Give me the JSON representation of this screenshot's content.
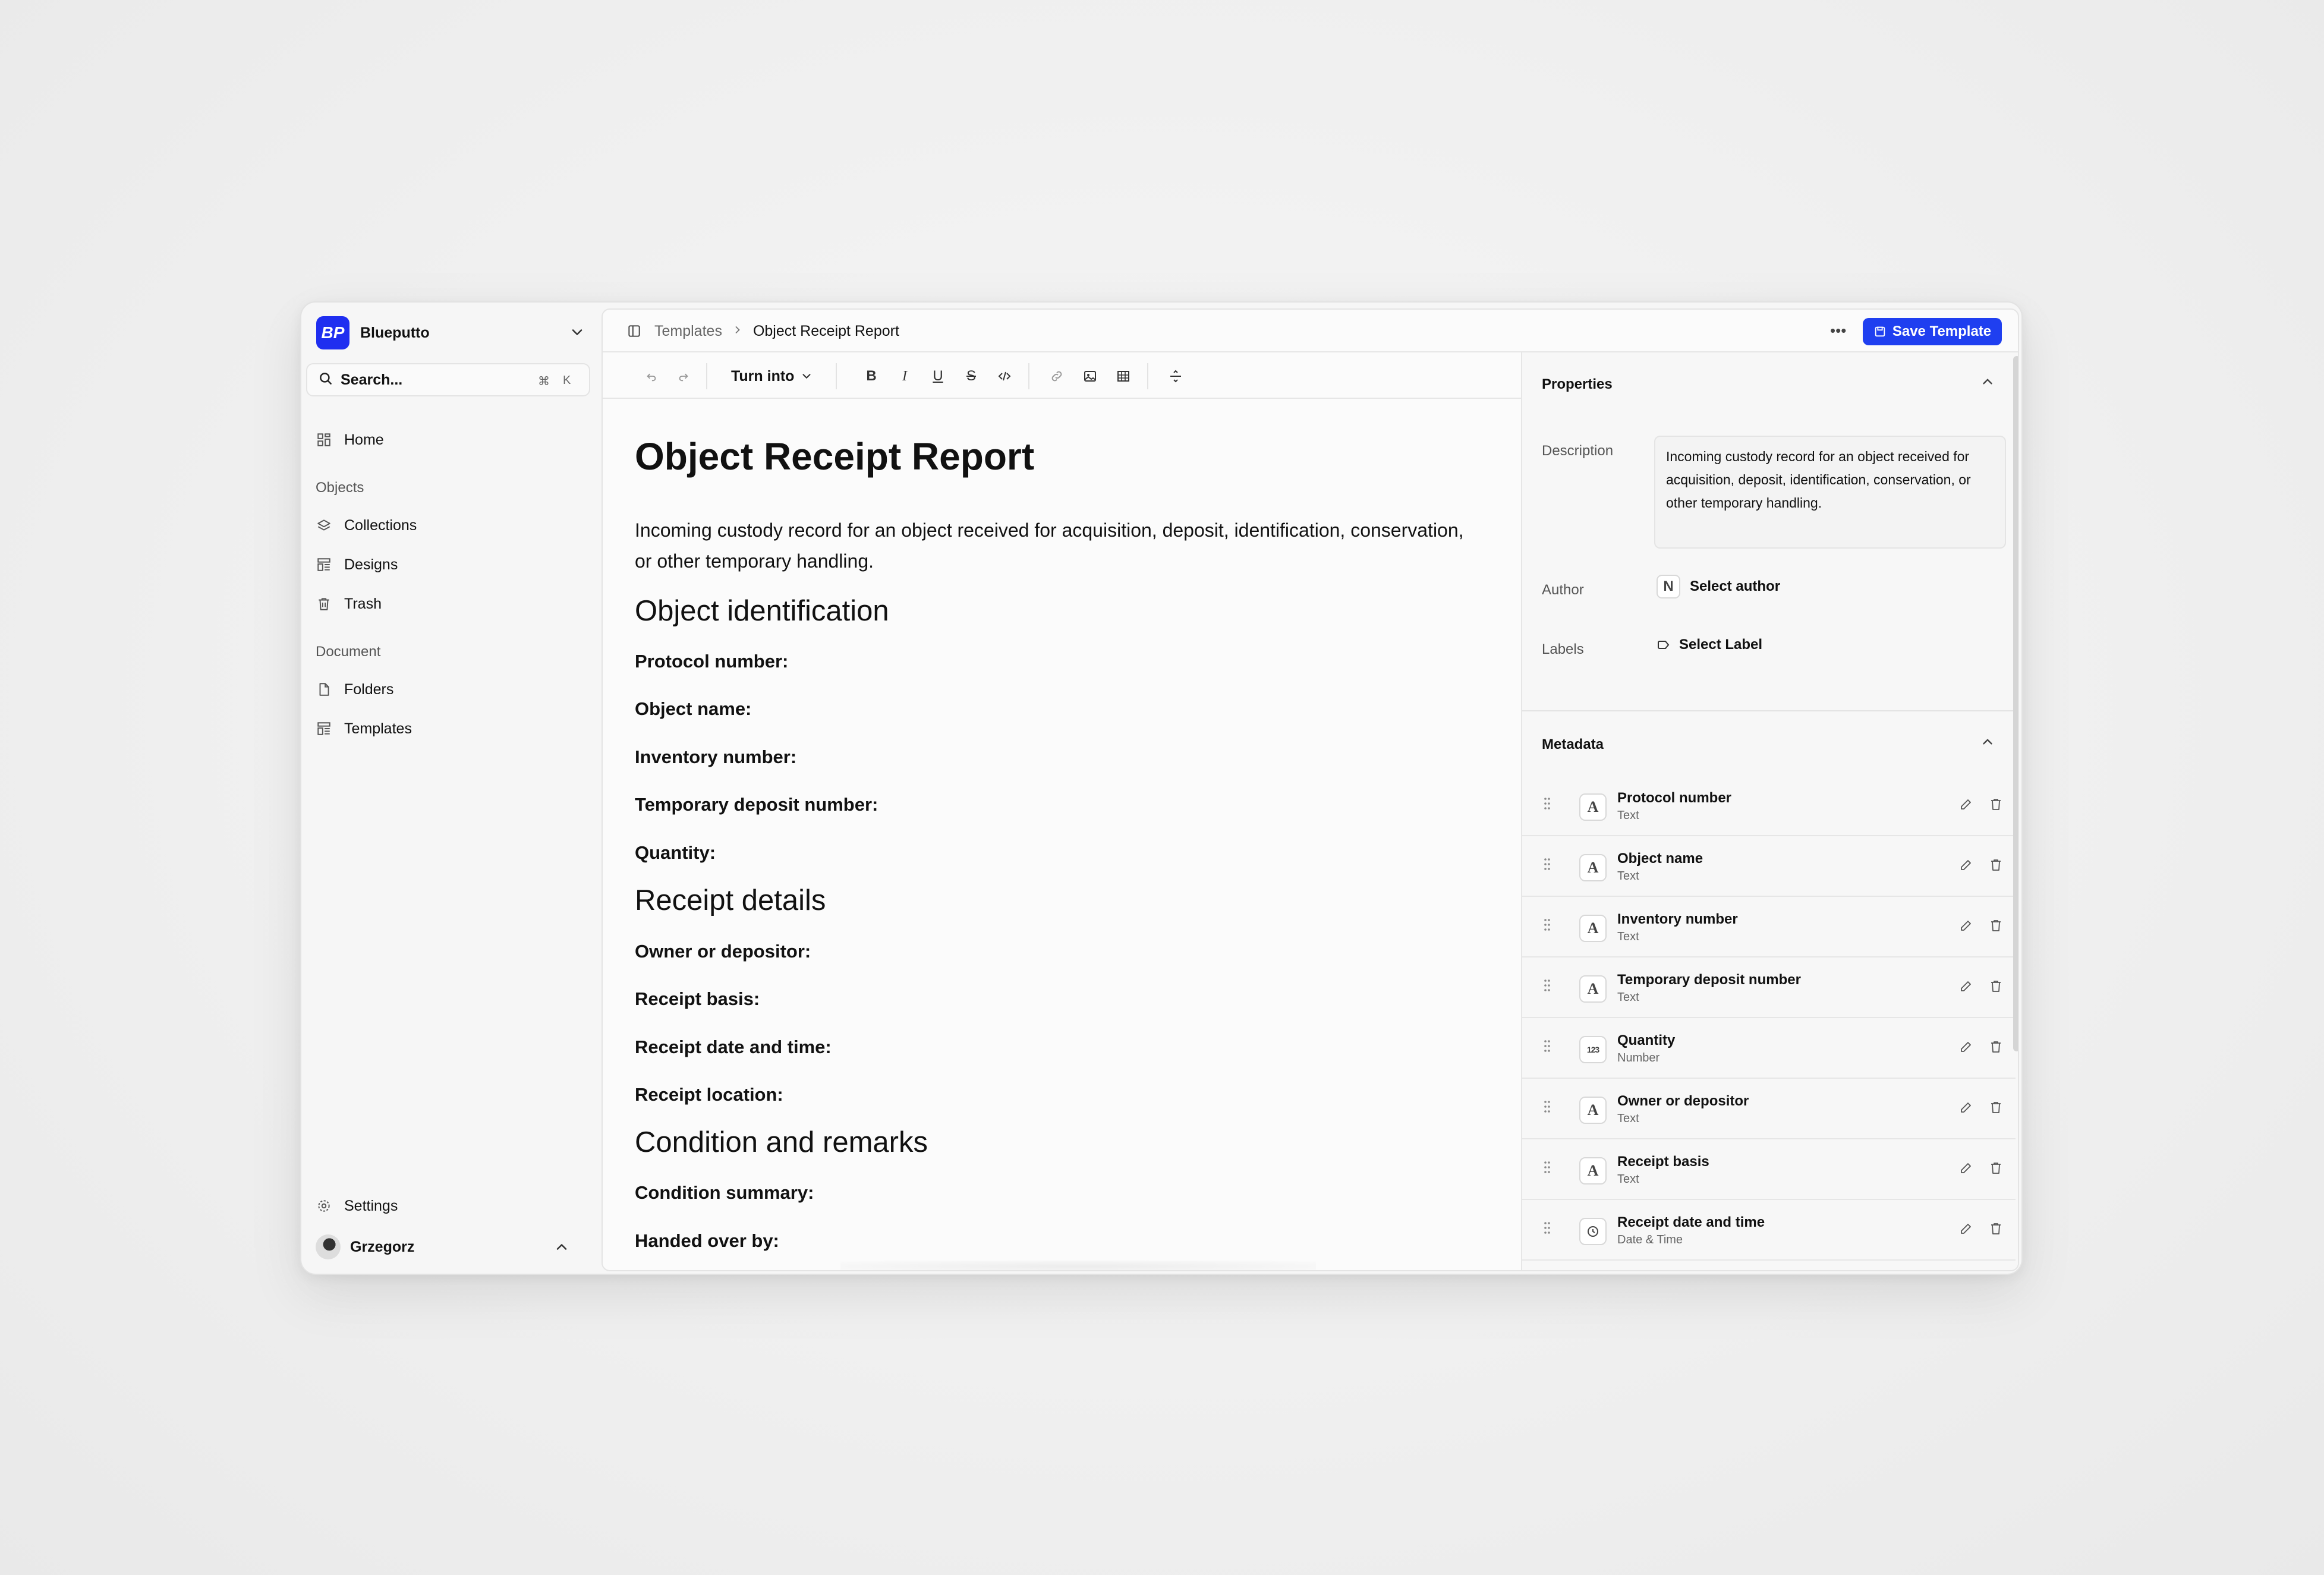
{
  "workspace": {
    "name": "Blueputto",
    "logo_text": "BP"
  },
  "search": {
    "placeholder": "Search...",
    "shortcut_cmd": "⌘",
    "shortcut_key": "K"
  },
  "nav": {
    "home": "Home",
    "objects_section": "Objects",
    "collections": "Collections",
    "designs": "Designs",
    "trash": "Trash",
    "document_section": "Document",
    "folders": "Folders",
    "templates": "Templates",
    "settings": "Settings"
  },
  "user": {
    "name": "Grzegorz"
  },
  "breadcrumb": {
    "parent": "Templates",
    "current": "Object Receipt Report"
  },
  "actions": {
    "save": "Save Template"
  },
  "toolbar": {
    "turn_into": "Turn into"
  },
  "document": {
    "title": "Object Receipt Report",
    "description": "Incoming custody record for an object received for acquisition, deposit, identification, conservation, or other temporary handling.",
    "sections": [
      {
        "heading": "Object identification",
        "fields": [
          "Protocol number:",
          "Object name:",
          "Inventory number:",
          "Temporary deposit number:",
          "Quantity:"
        ]
      },
      {
        "heading": "Receipt details",
        "fields": [
          "Owner or depositor:",
          "Receipt basis:",
          "Receipt date and time:",
          "Receipt location:"
        ]
      },
      {
        "heading": "Condition and remarks",
        "fields": [
          "Condition summary:",
          "Handed over by:"
        ]
      }
    ]
  },
  "properties": {
    "title": "Properties",
    "description_label": "Description",
    "description_value": "Incoming custody record for an object received for acquisition, deposit, identification, conservation, or other temporary handling.",
    "author_label": "Author",
    "author_badge": "N",
    "author_value": "Select author",
    "labels_label": "Labels",
    "labels_value": "Select Label"
  },
  "metadata": {
    "title": "Metadata",
    "items": [
      {
        "name": "Protocol number",
        "type": "Text",
        "icon": "text-type-icon"
      },
      {
        "name": "Object name",
        "type": "Text",
        "icon": "text-type-icon"
      },
      {
        "name": "Inventory number",
        "type": "Text",
        "icon": "text-type-icon"
      },
      {
        "name": "Temporary deposit number",
        "type": "Text",
        "icon": "text-type-icon"
      },
      {
        "name": "Quantity",
        "type": "Number",
        "icon": "number-type-icon"
      },
      {
        "name": "Owner or depositor",
        "type": "Text",
        "icon": "text-type-icon"
      },
      {
        "name": "Receipt basis",
        "type": "Text",
        "icon": "text-type-icon"
      },
      {
        "name": "Receipt date and time",
        "type": "Date & Time",
        "icon": "clock-type-icon"
      }
    ]
  },
  "colors": {
    "accent": "#1f3ff0",
    "logo": "#1f2ef0"
  }
}
